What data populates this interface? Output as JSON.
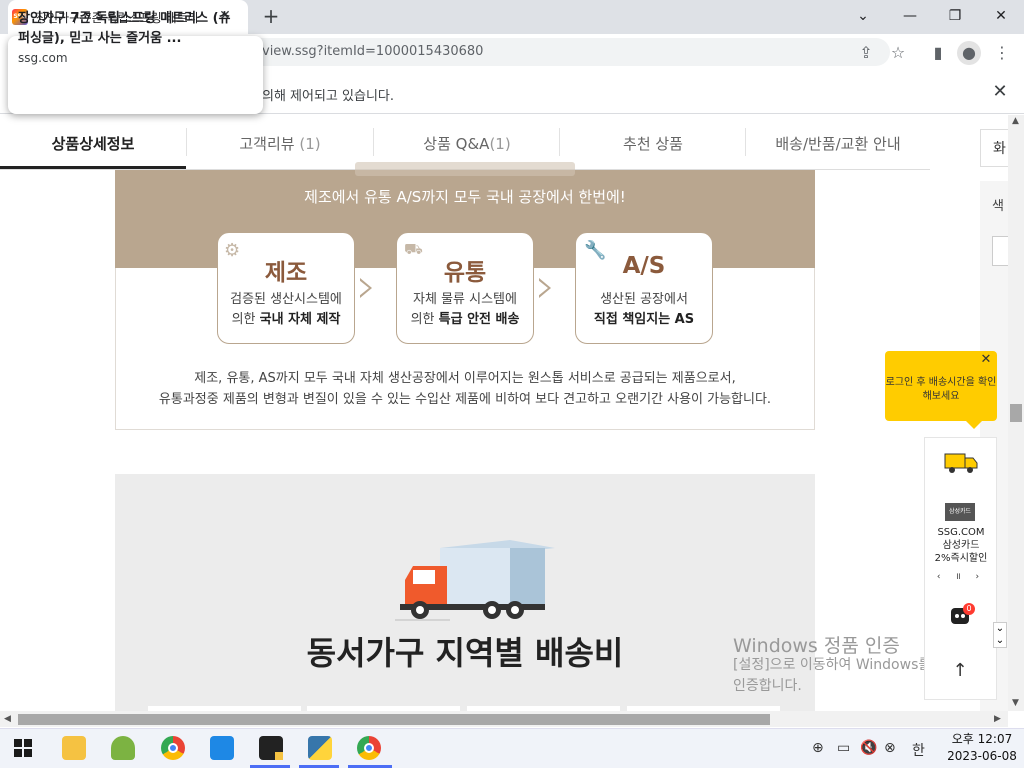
{
  "browser": {
    "tab_title": "장인가구 7존 독립스프링 매트리",
    "favicon_text": "SSG",
    "url": "view.ssg?itemId=1000015430680",
    "infobar_text": "의해 제어되고 있습니다.",
    "tooltip": {
      "title": "장인가구 7존 독립스프링 매트리스 (슈퍼싱글), 믿고 사는 즐거움 ...",
      "domain": "ssg.com"
    }
  },
  "page_nav": {
    "tabs": [
      {
        "label": "상품상세정보",
        "active": true
      },
      {
        "label": "고객리뷰",
        "count": "(1)"
      },
      {
        "label": "상품 Q&A",
        "count": "(1)"
      },
      {
        "label": "추천 상품"
      },
      {
        "label": "배송/반품/교환 안내"
      }
    ],
    "right_box_label": "화",
    "right_col_label": "색"
  },
  "banner": {
    "subtitle": "제조에서 유통 A/S까지 모두 국내 공장에서 한번에!",
    "cards": [
      {
        "title": "제조",
        "desc_line1": "검증된 생산시스템에",
        "desc_line2_plain": "의한 ",
        "desc_line2_bold": "국내 자체 제작",
        "icon": "gear-icon"
      },
      {
        "title": "유통",
        "desc_line1": "자체 물류 시스템에",
        "desc_line2_plain": "의한 ",
        "desc_line2_bold": "특급 안전 배송",
        "icon": "truck-icon"
      },
      {
        "title": "A/S",
        "desc_line1": "생산된 공장에서",
        "desc_line2_plain": "",
        "desc_line2_bold": "직접 책임지는 AS",
        "icon": "wrench-icon"
      }
    ],
    "footer_line1": "제조, 유통, AS까지 모두 국내 자체 생산공장에서 이루어지는 원스톱 서비스로 공급되는 제품으로서,",
    "footer_line2": "유통과정중 제품의 변형과 변질이 있을 수 있는 수입산 제품에 비하여 보다 견고하고 오랜기간 사용이 가능합니다."
  },
  "shipping": {
    "title": "동서가구 지역별 배송비"
  },
  "side": {
    "yellow_popup": "로그인 후 배송시간을 확인해보세요",
    "promo_card": "삼성카드",
    "promo_line1": "SSG.COM",
    "promo_line2": "삼성카드",
    "promo_line3": "2%즉시할인",
    "promo_controls": "‹ ॥ ›",
    "cart_badge": "0"
  },
  "watermark": {
    "line1": "Windows 정품 인증",
    "line2": "[설정]으로 이동하여 Windows를 정품",
    "line3": "인증합니다."
  },
  "taskbar": {
    "time": "오후 12:07",
    "date": "2023-06-08",
    "ime": "한"
  },
  "colors": {
    "banner_tan": "#b9a68f",
    "card_title": "#8b5a3c",
    "popup_yellow": "#ffcc00",
    "taskbar_bg": "#f0f3f9"
  }
}
